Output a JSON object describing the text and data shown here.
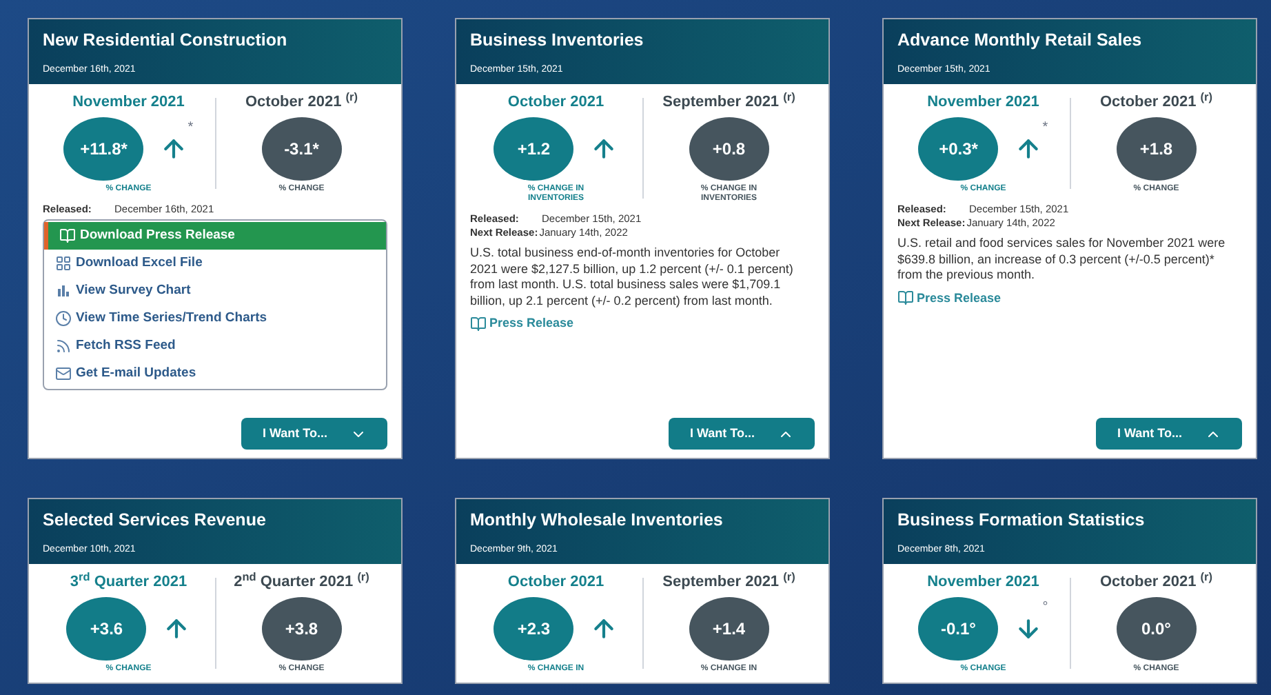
{
  "cards": [
    {
      "title": "New Residential Construction",
      "date": "December 16th, 2021",
      "current": {
        "label": "November 2021",
        "value": "+11.8*",
        "caption": "% CHANGE"
      },
      "rising": true,
      "direction_mark": "*",
      "previous": {
        "label": "October 2021 $^{(r)}$",
        "value": "-3.1*",
        "caption": "% CHANGE"
      },
      "released_label": "Released:",
      "released": "December 16th, 2021",
      "menu_expanded": true,
      "menu": [
        {
          "kind": "document",
          "label": "Download Press Release",
          "selected": true
        },
        {
          "kind": "grid",
          "label": "Download Excel File",
          "selected": false
        },
        {
          "kind": "chart",
          "label": "View Survey Chart",
          "selected": false
        },
        {
          "kind": "clock",
          "label": "View Time Series/Trend Charts",
          "selected": false
        },
        {
          "kind": "rss",
          "label": "Fetch RSS Feed",
          "selected": false
        },
        {
          "kind": "mail",
          "label": "Get E-mail Updates",
          "selected": false
        }
      ],
      "button": "I Want To..."
    },
    {
      "title": "Business Inventories",
      "date": "December 15th, 2021",
      "current": {
        "label": "October 2021",
        "value": "+1.2",
        "caption": "% CHANGE IN INVENTORIES"
      },
      "rising": true,
      "previous": {
        "label": "September 2021 $^{(r)}$",
        "value": "+0.8",
        "caption": "% CHANGE IN INVENTORIES"
      },
      "released_label": "Released:",
      "released": "December 15th, 2021",
      "next_label": "Next Release:",
      "next_release": "January 14th, 2022",
      "description": "U.S. total business end-of-month inventories for October 2021 were $2,127.5 billion, up 1.2 percent (+/- 0.1 percent) from last month. U.S. total business sales were $1,709.1 billion, up 2.1 percent (+/- 0.2 percent) from last month.",
      "link": "Press Release",
      "menu_expanded": false,
      "button": "I Want To..."
    },
    {
      "title": "Advance Monthly Retail Sales",
      "date": "December 15th, 2021",
      "current": {
        "label": "November 2021",
        "value": "+0.3*",
        "caption": "% CHANGE"
      },
      "rising": true,
      "direction_mark": "*",
      "previous": {
        "label": "October 2021 $^{(r)}$",
        "value": "+1.8",
        "caption": "% CHANGE"
      },
      "released_label": "Released:",
      "released": "December 15th, 2021",
      "next_label": "Next Release:",
      "next_release": "January 14th, 2022",
      "description": "U.S. retail and food services sales for November 2021 were $639.8 billion, an increase of 0.3 percent (+/-0.5 percent)* from the previous month.",
      "link": "Press Release",
      "menu_expanded": false,
      "button": "I Want To..."
    },
    {
      "title": "Selected Services Revenue",
      "date": "December 10th, 2021",
      "current": {
        "label": "3$^{rd}$ Quarter 2021",
        "value": "+3.6",
        "caption": "% CHANGE"
      },
      "rising": true,
      "previous": {
        "label": "2$^{nd}$ Quarter 2021 $^{(r)}$",
        "value": "+3.8",
        "caption": "% CHANGE"
      }
    },
    {
      "title": "Monthly Wholesale Inventories",
      "date": "December 9th, 2021",
      "current": {
        "label": "October 2021",
        "value": "+2.3",
        "caption": "% CHANGE IN"
      },
      "rising": true,
      "previous": {
        "label": "September 2021 $^{(r)}$",
        "value": "+1.4",
        "caption": "% CHANGE IN"
      }
    },
    {
      "title": "Business Formation Statistics",
      "date": "December 8th, 2021",
      "current": {
        "label": "November 2021",
        "value": "-0.1°",
        "caption": "% CHANGE"
      },
      "rising": false,
      "direction_mark": "°",
      "previous": {
        "label": "October 2021 $^{(r)}$",
        "value": "0.0°",
        "caption": "% CHANGE"
      }
    }
  ]
}
